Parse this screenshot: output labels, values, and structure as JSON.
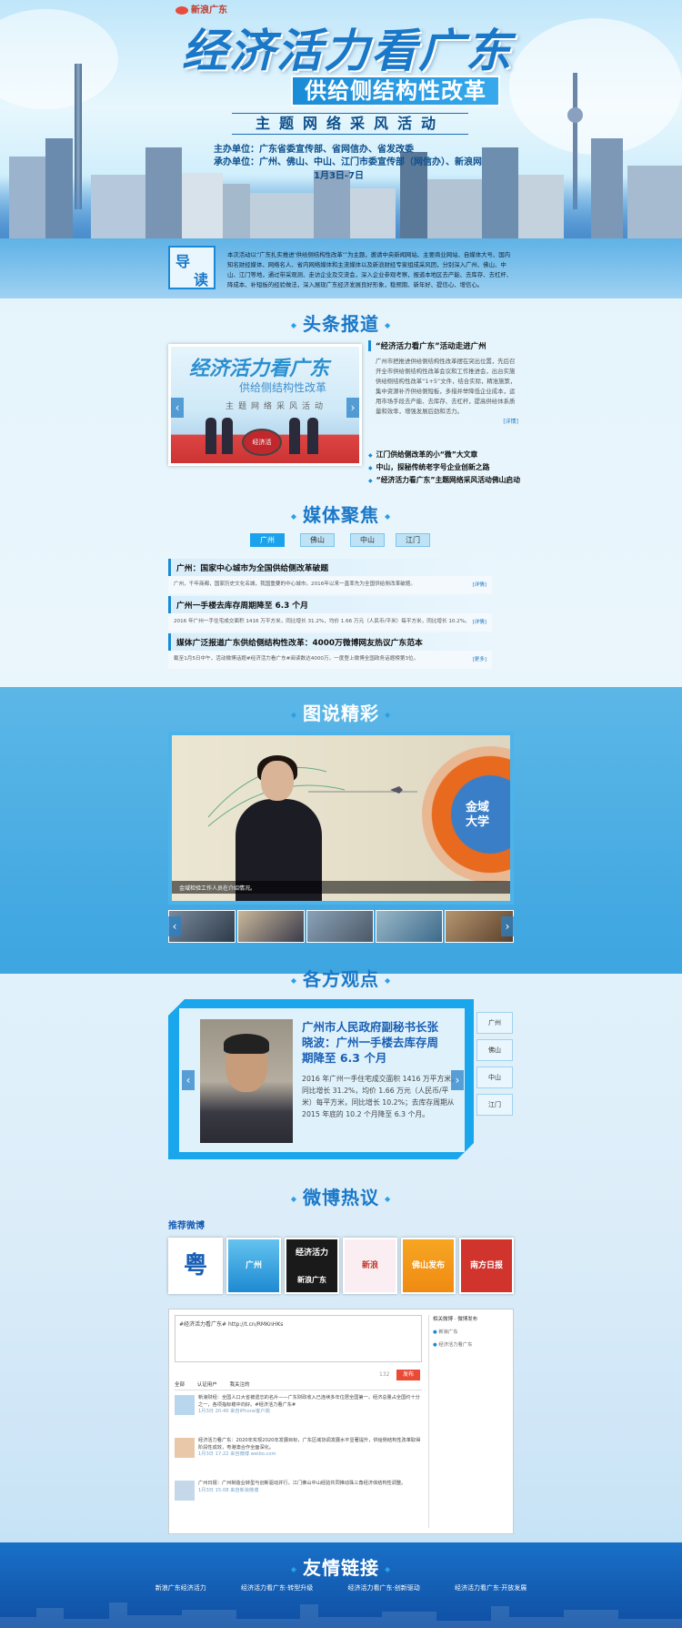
{
  "banner": {
    "logo": "新浪广东",
    "title": "经济活力看广东",
    "subtitle": "供给侧结构性改革",
    "theme": "主题网络采风活动",
    "organizer": "主办单位：广东省委宣传部、省网信办、省发改委",
    "co_organizer": "承办单位：广州、佛山、中山、江门市委宣传部（网信办）、新浪网",
    "date": "1月3日-7日"
  },
  "intro": {
    "label_1": "导",
    "label_2": "读",
    "text": "本次活动以“广东扎实推进‘供给侧结构性改革’”为主题，邀请中央新闻网站、主要商业网站、自媒体大号、国内知名财经媒体、网络名人、省内网络媒体和主流媒体以及新浪财经专家组成采风团，分别深入广州、佛山、中山、江门等地，通过带采观测、走访企业及交流会，深入企业参观考察，报道本地区去产能、去库存、去杠杆、降成本、补短板的经验做法，深入展现广东经济发展良好形象，稳预期、新年好、提信心、增信心。"
  },
  "sections": {
    "headlines": "头条报道",
    "media": "媒体聚焦",
    "pictures": "图说精彩",
    "opinions": "各方观点",
    "weibo": "微博热议",
    "links": "友情链接"
  },
  "headlines": {
    "image": {
      "title": "经济活力看广东",
      "subtitle": "供给侧结构性改革",
      "theme": "主题网络采风活动",
      "stamp": "经济活"
    },
    "main_title": "“经济活力看广东”活动走进广州",
    "main_text": "广州市把推进供给侧结构性改革摆在突出位置，先后召开全市供给侧结构性改革会议和工作推进会，出台实施供给侧结构性改革“1+5”文件，结合实际，精准施策，集中资源补齐供给侧短板，多措并举降低企业成本，运用市场手段去产能、去库存、去杠杆，提高供给体系质量和效率，增强发展后劲和活力。",
    "more": "[详情]",
    "list": [
      "江门供给侧改革的小“微”大文章",
      "中山，探秘传统老字号企业创新之路",
      "“经济活力看广东”主题网络采风活动佛山启动"
    ],
    "arrow_prev": "‹",
    "arrow_next": "›"
  },
  "media": {
    "tabs": [
      "广州",
      "佛山",
      "中山",
      "江门"
    ],
    "news": [
      {
        "title": "广州：国家中心城市为全国供给侧改革破题",
        "text": "广州，千年商都，国家历史文化名城，我国重要的中心城市。2016年以来一直率先为全国供给侧改革破题。",
        "more": "[详情]"
      },
      {
        "title": "广州一手楼去库存周期降至 6.3 个月",
        "text": "2016 年广州一手住宅成交面积 1416 万平方米，同比增长 31.2%，均价 1.66 万元（人民币/平米）每平方米，同比增长 10.2%。",
        "more": "[详情]"
      },
      {
        "title": "媒体广泛报道广东供给侧结构性改革：4000万微博网友热议广东范本",
        "text": "截至1月5日中午，活动微博话题#经济活力看广东#阅读数达4000万，一度登上微博全国政务话题榜第3位。",
        "more": "[更多]"
      }
    ]
  },
  "pictures": {
    "orb_text": "金域大学",
    "caption": "金域检验工作人员在介绍情况。",
    "prev": "‹",
    "next": "›"
  },
  "opinions": {
    "title": "广州市人民政府副秘书长张晓波：广州一手楼去库存周期降至 6.3 个月",
    "text": "2016 年广州一手住宅成交面积 1416 万平方米，同比增长 31.2%，均价 1.66 万元（人民币/平米）每平方米，同比增长 10.2%；去库存周期从 2015 年底的 10.2 个月降至 6.3 个月。",
    "tabs": [
      "广州",
      "佛山",
      "中山",
      "江门"
    ],
    "prev": "‹",
    "next": "›"
  },
  "weibo": {
    "recommend_label": "推荐微博",
    "icons": [
      "粤",
      "广州",
      "经济活力",
      "新浪",
      "佛山发布",
      "南方日报"
    ],
    "icon_sub": [
      "",
      "",
      "",
      "新浪广东",
      "",
      ""
    ],
    "input_text": "#经济活力看广东# http://t.cn/RMKnHKs",
    "count": "132",
    "send": "发布",
    "tabs": [
      "全部",
      "认证用户",
      "我关注的"
    ],
    "posts": [
      {
        "text": "新浪财经：全国人口大省被遗忘的名片——广东财政收入已连续多年位居全国第一，经济总量占全国约十分之一，各项指标稳中向好。#经济活力看广东#",
        "meta": "1月3日 20:40 来自iPhone客户端"
      },
      {
        "text": "经济活力看广东：2020年实现2020年发展目标，广东区域协调发展水平显著提升，供给侧结构性改革取得阶段性成效，粤港澳合作全面深化。",
        "meta": "1月3日 17:22 来自微博 weibo.com"
      },
      {
        "text": "广州日报：广州制造业转型与创新驱动并行，江门佛山中山经验共同推动珠三角经济体结构性调整。",
        "meta": "1月3日 15:08 来自新浪微博"
      }
    ],
    "right_title": "相关微博 · 微博发布",
    "right_items": [
      "新浪广东",
      "经济活力看广东"
    ]
  },
  "links": [
    "新浪广东经济活力",
    "经济活力看广东·转型升级",
    "经济活力看广东·创新驱动",
    "经济活力看广东·开放发展"
  ]
}
